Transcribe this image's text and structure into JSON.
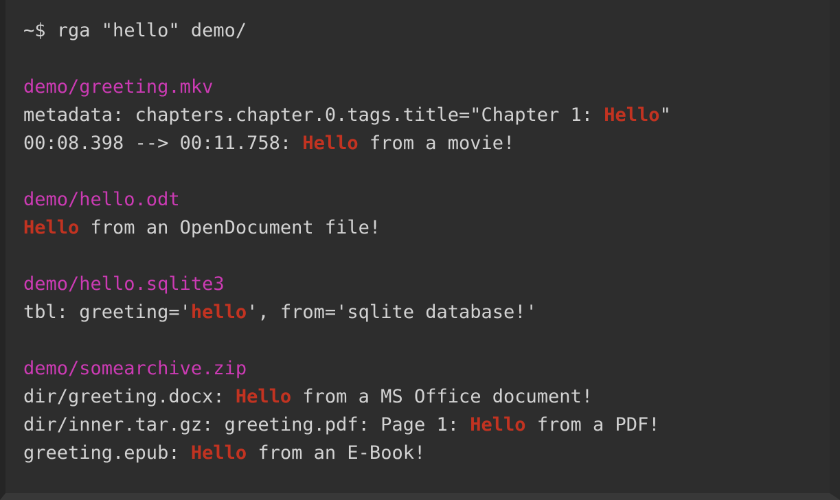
{
  "terminal": {
    "colors": {
      "background": "#2d2d2d",
      "foreground": "#d2d2d2",
      "filename": "#cc3bb4",
      "match": "#c23321",
      "frame_left": "#252525",
      "frame_bottom": "#383838"
    },
    "prompt": "~$ ",
    "command": "rga \"hello\" demo/",
    "lines": [
      {
        "type": "command",
        "name": "command-line",
        "segments": [
          {
            "style": "prompt",
            "text": "~$ "
          },
          {
            "style": "plain",
            "text": "rga \"hello\" demo/"
          }
        ]
      },
      {
        "type": "blank",
        "name": "blank-line",
        "segments": [
          {
            "style": "plain",
            "text": " "
          }
        ]
      },
      {
        "type": "filename",
        "name": "result-filename",
        "segments": [
          {
            "style": "file",
            "text": "demo/greeting.mkv"
          }
        ]
      },
      {
        "type": "result",
        "name": "result-line",
        "segments": [
          {
            "style": "plain",
            "text": "metadata: chapters.chapter.0.tags.title=\"Chapter 1: "
          },
          {
            "style": "match",
            "text": "Hello"
          },
          {
            "style": "plain",
            "text": "\""
          }
        ]
      },
      {
        "type": "result",
        "name": "result-line",
        "segments": [
          {
            "style": "plain",
            "text": "00:08.398 --> 00:11.758: "
          },
          {
            "style": "match",
            "text": "Hello"
          },
          {
            "style": "plain",
            "text": " from a movie!"
          }
        ]
      },
      {
        "type": "blank",
        "name": "blank-line",
        "segments": [
          {
            "style": "plain",
            "text": " "
          }
        ]
      },
      {
        "type": "filename",
        "name": "result-filename",
        "segments": [
          {
            "style": "file",
            "text": "demo/hello.odt"
          }
        ]
      },
      {
        "type": "result",
        "name": "result-line",
        "segments": [
          {
            "style": "match",
            "text": "Hello"
          },
          {
            "style": "plain",
            "text": " from an OpenDocument file!"
          }
        ]
      },
      {
        "type": "blank",
        "name": "blank-line",
        "segments": [
          {
            "style": "plain",
            "text": " "
          }
        ]
      },
      {
        "type": "filename",
        "name": "result-filename",
        "segments": [
          {
            "style": "file",
            "text": "demo/hello.sqlite3"
          }
        ]
      },
      {
        "type": "result",
        "name": "result-line",
        "segments": [
          {
            "style": "plain",
            "text": "tbl: greeting='"
          },
          {
            "style": "match",
            "text": "hello"
          },
          {
            "style": "plain",
            "text": "', from='sqlite database!'"
          }
        ]
      },
      {
        "type": "blank",
        "name": "blank-line",
        "segments": [
          {
            "style": "plain",
            "text": " "
          }
        ]
      },
      {
        "type": "filename",
        "name": "result-filename",
        "segments": [
          {
            "style": "file",
            "text": "demo/somearchive.zip"
          }
        ]
      },
      {
        "type": "result",
        "name": "result-line",
        "segments": [
          {
            "style": "plain",
            "text": "dir/greeting.docx: "
          },
          {
            "style": "match",
            "text": "Hello"
          },
          {
            "style": "plain",
            "text": " from a MS Office document!"
          }
        ]
      },
      {
        "type": "result",
        "name": "result-line",
        "segments": [
          {
            "style": "plain",
            "text": "dir/inner.tar.gz: greeting.pdf: Page 1: "
          },
          {
            "style": "match",
            "text": "Hello"
          },
          {
            "style": "plain",
            "text": " from a PDF!"
          }
        ]
      },
      {
        "type": "result",
        "name": "result-line",
        "segments": [
          {
            "style": "plain",
            "text": "greeting.epub: "
          },
          {
            "style": "match",
            "text": "Hello"
          },
          {
            "style": "plain",
            "text": " from an E-Book!"
          }
        ]
      }
    ]
  }
}
